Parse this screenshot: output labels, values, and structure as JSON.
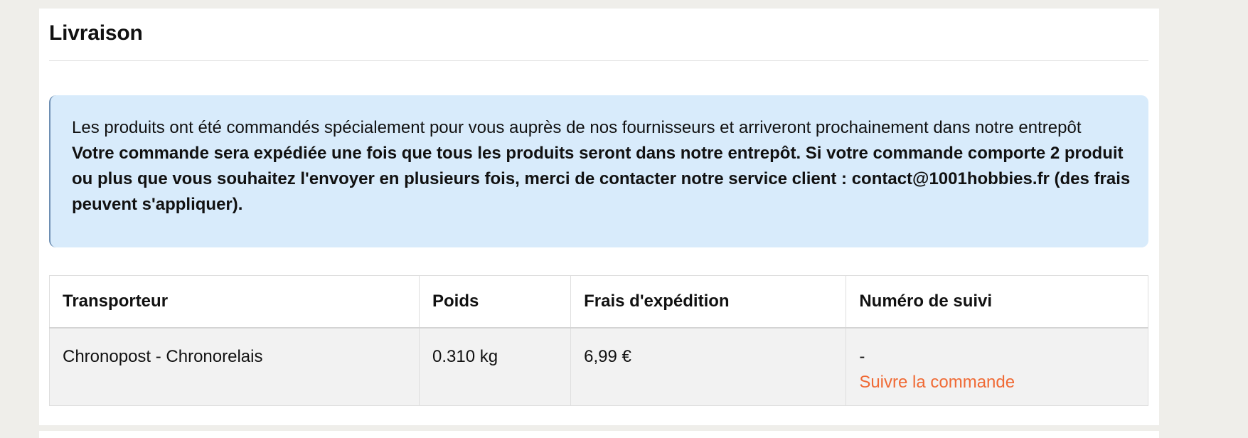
{
  "section": {
    "title": "Livraison"
  },
  "notice": {
    "text": "Les produits ont été commandés spécialement pour vous auprès de nos fournisseurs et arriveront prochainement dans notre entrepôt",
    "bold_text": "Votre commande sera expédiée une fois que tous les produits seront dans notre entrepôt. Si votre commande comporte 2 produit ou plus que vous souhaitez l'envoyer en plusieurs fois, merci de contacter notre service client : contact@1001hobbies.fr (des frais peuvent s'appliquer)."
  },
  "table": {
    "headers": {
      "carrier": "Transporteur",
      "weight": "Poids",
      "fees": "Frais d'expédition",
      "tracking": "Numéro de suivi"
    },
    "rows": [
      {
        "carrier": "Chronopost - Chronorelais",
        "weight": "0.310 kg",
        "fees": "6,99 €",
        "tracking_number": "-",
        "tracking_link": "Suivre la commande"
      }
    ]
  },
  "colors": {
    "page_background": "#efeeea",
    "card_background": "#ffffff",
    "notice_background": "#d8ebfb",
    "link": "#f06a35"
  }
}
